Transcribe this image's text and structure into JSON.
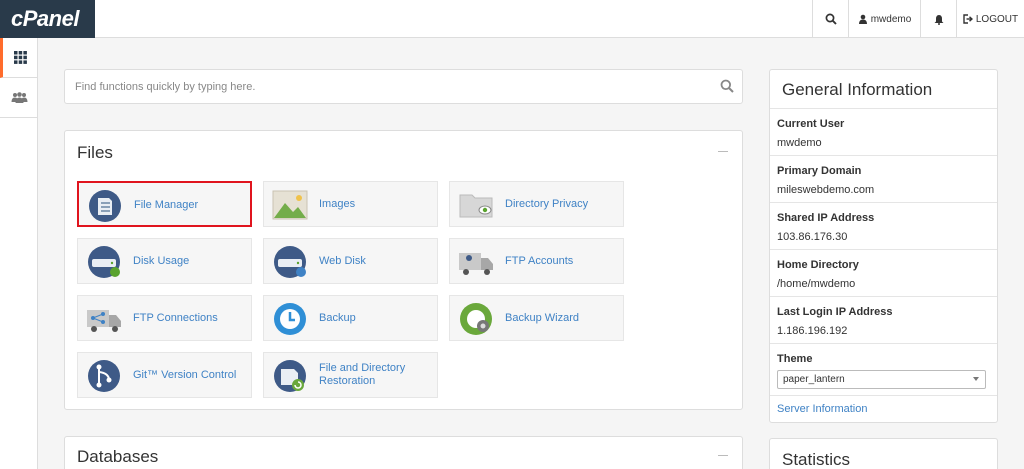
{
  "brand": {
    "logo_text": "cPanel",
    "bg_color": "#293a4a",
    "accent": "#ff6c2c"
  },
  "topbar": {
    "search_icon": "search-icon",
    "user_label": "mwdemo",
    "bell_icon": "bell-icon",
    "logout_label": "LOGOUT"
  },
  "sidebar": {
    "items": [
      {
        "icon": "grid-icon",
        "active": true
      },
      {
        "icon": "users-icon",
        "active": false
      }
    ]
  },
  "search": {
    "placeholder": "Find functions quickly by typing here."
  },
  "files": {
    "title": "Files",
    "tiles": [
      {
        "label": "File Manager",
        "icon": "file-manager-icon",
        "highlighted": true
      },
      {
        "label": "Images",
        "icon": "images-icon"
      },
      {
        "label": "Directory Privacy",
        "icon": "directory-privacy-icon"
      },
      {
        "label": "Disk Usage",
        "icon": "disk-usage-icon"
      },
      {
        "label": "Web Disk",
        "icon": "web-disk-icon"
      },
      {
        "label": "FTP Accounts",
        "icon": "ftp-accounts-icon"
      },
      {
        "label": "FTP Connections",
        "icon": "ftp-connections-icon"
      },
      {
        "label": "Backup",
        "icon": "backup-icon"
      },
      {
        "label": "Backup Wizard",
        "icon": "backup-wizard-icon"
      },
      {
        "label": "Git™ Version Control",
        "icon": "git-icon"
      },
      {
        "label": "File and Directory Restoration",
        "icon": "file-restoration-icon"
      }
    ]
  },
  "databases": {
    "title": "Databases"
  },
  "general_info": {
    "title": "General Information",
    "rows": [
      {
        "label": "Current User",
        "value": "mwdemo"
      },
      {
        "label": "Primary Domain",
        "value": "mileswebdemo.com"
      },
      {
        "label": "Shared IP Address",
        "value": "103.86.176.30"
      },
      {
        "label": "Home Directory",
        "value": "/home/mwdemo"
      },
      {
        "label": "Last Login IP Address",
        "value": "1.186.196.192"
      }
    ],
    "theme_label": "Theme",
    "theme_value": "paper_lantern",
    "server_info_link": "Server Information"
  },
  "statistics": {
    "title": "Statistics"
  },
  "colors": {
    "link": "#3f82c5",
    "highlight_border": "#e0141e"
  }
}
